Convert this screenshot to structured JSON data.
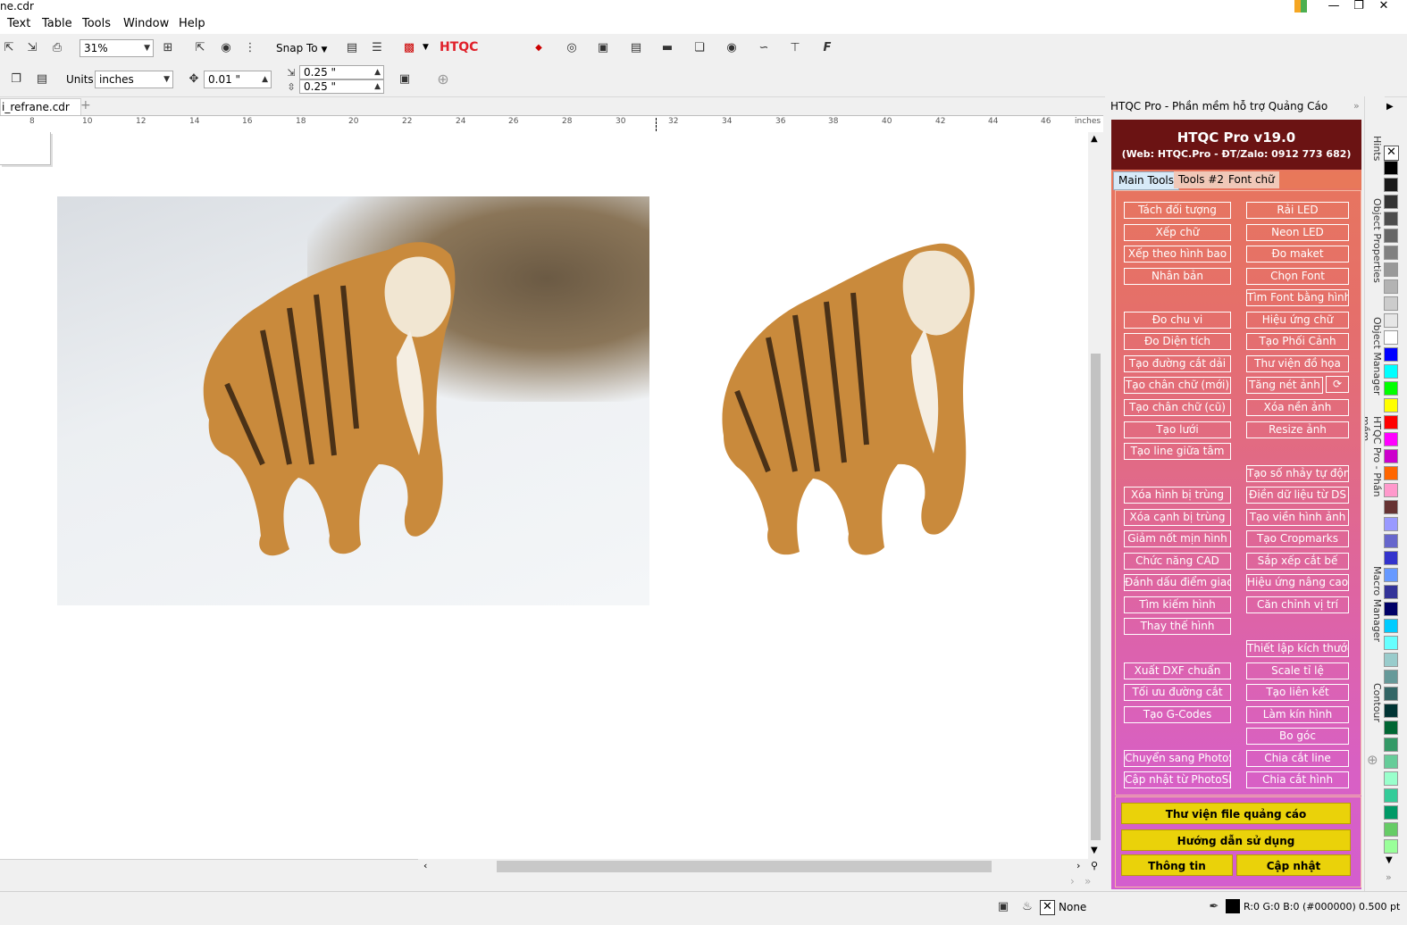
{
  "window": {
    "title": "ne.cdr"
  },
  "menu": [
    "Text",
    "Table",
    "Tools",
    "Window",
    "Help"
  ],
  "toolbar": {
    "zoom": "31%",
    "snap_to": "Snap To",
    "htqc_label": "HTQC",
    "units_label": "Units:",
    "units_value": "inches",
    "nudge_value": "0.01 \"",
    "dup_x": "0.25 \"",
    "dup_y": "0.25 \""
  },
  "document_tab": {
    "label": "i_refrane.cdr"
  },
  "ruler": {
    "labels": [
      "8",
      "10",
      "12",
      "14",
      "16",
      "18",
      "20",
      "22",
      "24",
      "26",
      "28",
      "30",
      "32",
      "34",
      "36",
      "38",
      "40",
      "42",
      "44",
      "46"
    ],
    "unit": "inches"
  },
  "htqc_panel": {
    "title": "HTQC Pro - Phần mềm hỗ trợ Quảng Cáo",
    "heading": "HTQC Pro v19.0",
    "subheading": "(Web: HTQC.Pro - ĐT/Zalo: 0912 773 682)",
    "tabs": [
      "Main Tools",
      "Tools #2",
      "Font chữ"
    ],
    "left_buttons": [
      "Tách đối tượng",
      "Xếp chữ",
      "Xếp theo hình bao",
      "Nhân bản",
      "",
      "Đo chu vi",
      "Đo Diện tích",
      "Tạo đường cắt dải",
      "Tạo chân chữ (mới)",
      "Tạo chân chữ (cũ)",
      "Tạo lưới",
      "Tạo line giữa tâm",
      "",
      "Xóa hình bị trùng",
      "Xóa cạnh bị trùng",
      "Giảm nốt mịn hình",
      "Chức năng CAD",
      "Đánh dấu điểm giao",
      "Tìm kiếm hình",
      "Thay thế hình",
      "",
      "Xuất DXF chuẩn",
      "Tối ưu đường cắt",
      "Tạo G-Codes",
      "",
      "Chuyển sang PhotoSh",
      "Cập nhật từ PhotoSho"
    ],
    "right_buttons": [
      "Rải LED",
      "Neon LED",
      "Đo maket",
      "Chọn Font",
      "Tìm Font bằng hình",
      "Hiệu ứng chữ",
      "Tạo Phối Cảnh",
      "Thư viện đồ họa",
      "Tăng nét ảnh",
      "Xóa nền ảnh",
      "Resize ảnh",
      "",
      "Tạo số nhảy tự động",
      "Điền dữ liệu từ DS",
      "Tạo viền hình ảnh",
      "Tạo Cropmarks",
      "Sắp xếp cắt bế",
      "Hiệu ứng nâng cao",
      "Căn chỉnh vị trí",
      "",
      "Thiết lập kích thước",
      "Scale tỉ lệ",
      "Tạo liên kết",
      "Làm kín hình",
      "Bo góc",
      "Chia cắt line",
      "Chia cắt hình"
    ],
    "refresh_icon_label": "⟳",
    "library_button": "Thư viện file quảng cáo",
    "guide_button": "Hướng dẫn sử dụng",
    "info_button": "Thông tin",
    "update_button": "Cập nhật"
  },
  "dock_tabs": [
    "Hints",
    "Object Properties",
    "Object Manager",
    "HTQC Pro - Phần mềm...",
    "Macro Manager",
    "Contour"
  ],
  "status": {
    "fill_label": "None",
    "outline_color": "R:0 G:0 B:0 (#000000)",
    "outline_width": "0.500 pt"
  },
  "colors": {
    "panel_head": "#6b1313",
    "yellow_button": "#ead20a",
    "htqc_red": "#e0202a"
  }
}
